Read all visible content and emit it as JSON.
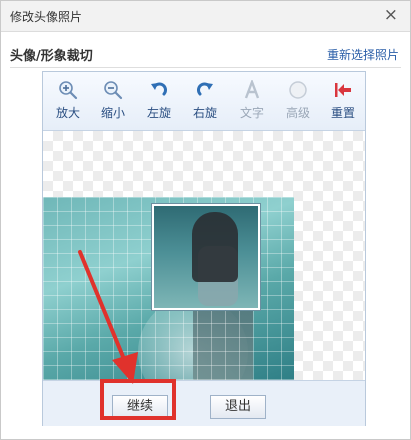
{
  "dialog": {
    "title": "修改头像照片",
    "close_glyph": "×"
  },
  "section": {
    "heading": "头像/形象裁切",
    "reselect_label": "重新选择照片"
  },
  "toolbar": {
    "tools": [
      {
        "label": "放大",
        "icon": "zoom-in-icon",
        "enabled": true
      },
      {
        "label": "缩小",
        "icon": "zoom-out-icon",
        "enabled": true
      },
      {
        "label": "左旋",
        "icon": "rotate-left-icon",
        "enabled": true
      },
      {
        "label": "右旋",
        "icon": "rotate-right-icon",
        "enabled": true
      },
      {
        "label": "文字",
        "icon": "text-icon",
        "enabled": false
      },
      {
        "label": "高级",
        "icon": "advanced-icon",
        "enabled": false
      },
      {
        "label": "重置",
        "icon": "reset-icon",
        "enabled": true
      }
    ]
  },
  "buttons": {
    "continue_label": "继续",
    "exit_label": "退出"
  },
  "colors": {
    "highlight": "#e0322c",
    "link": "#2a5ea8",
    "tool_label": "#2b4f82"
  }
}
